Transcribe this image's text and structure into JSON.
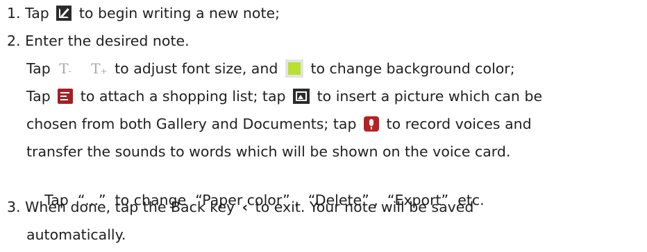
{
  "steps": [
    {
      "num": "1.",
      "before": "Tap",
      "icon": "compose-icon",
      "after": "to begin writing a new note;"
    },
    {
      "num": "2.",
      "text": "Enter the desired note.",
      "sub": {
        "font": {
          "before": "Tap",
          "t_minus": "T",
          "minus": "-",
          "t_plus": "T",
          "plus": "+",
          "middle": "to adjust font size, and",
          "after": "to change background color;"
        },
        "attach": {
          "before": "Tap",
          "list_after": "to attach a shopping list; tap",
          "pic_after": "to insert a picture which can be"
        },
        "gallery": {
          "before": "chosen from both Gallery and Documents; tap",
          "after": "to record voices and"
        },
        "transfer": "transfer the sounds to words which will be shown on the voice card.",
        "more": "Tap  “...”  to change  “Paper color” ,  “Delete” ,  “Export”  etc."
      }
    },
    {
      "num": "3.",
      "before": "When done, tap the Back key",
      "back_glyph": "‹",
      "after": "to exit. Your note will be saved",
      "cont": "automatically."
    }
  ],
  "icons": {
    "compose": "compose-icon",
    "font_smaller": "font-smaller-icon",
    "font_larger": "font-larger-icon",
    "background_color": "background-color-icon",
    "shopping_list": "shopping-list-icon",
    "picture": "picture-icon",
    "voice": "microphone-icon",
    "back": "back-icon"
  },
  "colors": {
    "text": "#1f1f1f",
    "swatch": "#b8e02e",
    "list_icon": "#a32024",
    "mic_icon": "#b52125"
  }
}
